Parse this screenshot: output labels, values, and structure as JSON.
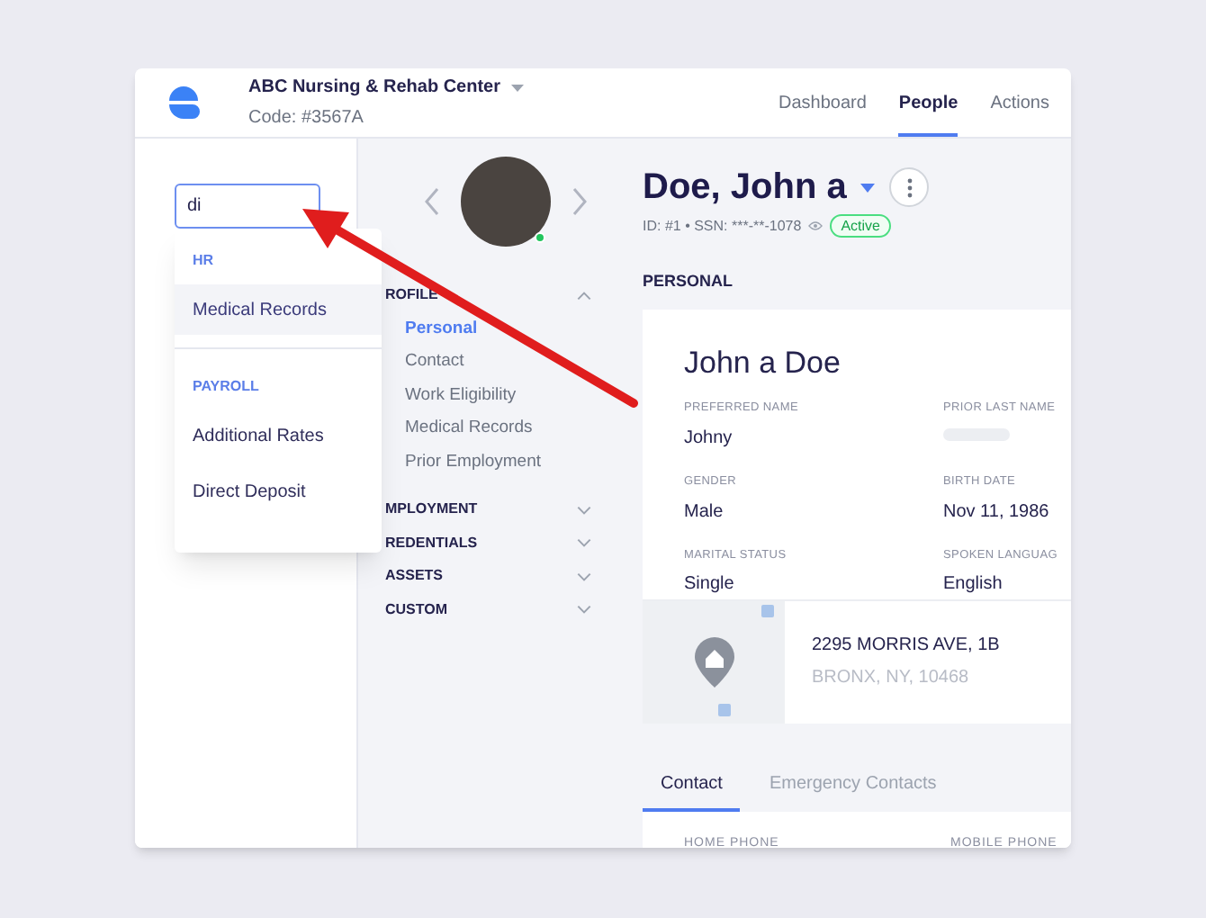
{
  "header": {
    "org_name": "ABC Nursing & Rehab Center",
    "org_code": "Code: #3567A",
    "nav": [
      {
        "label": "Dashboard",
        "selected": false
      },
      {
        "label": "People",
        "selected": true
      },
      {
        "label": "Actions",
        "selected": false
      }
    ]
  },
  "search": {
    "value": "di"
  },
  "search_results": [
    {
      "group": "HR",
      "items": [
        {
          "label": "Medical Records",
          "selected": true
        }
      ]
    },
    {
      "group": "PAYROLL",
      "items": [
        {
          "label": "Additional Rates",
          "selected": false
        },
        {
          "label": "Direct Deposit",
          "selected": false
        }
      ]
    }
  ],
  "person": {
    "name": "Doe, John a",
    "id_line": "ID: #1 • SSN: ***-**-1078",
    "status": "Active",
    "online": true
  },
  "sections": [
    {
      "label": "ROFILE",
      "expanded": true,
      "children": [
        {
          "label": "Personal",
          "selected": true
        },
        {
          "label": "Contact",
          "selected": false
        },
        {
          "label": "Work Eligibility",
          "selected": false
        },
        {
          "label": "Medical Records",
          "selected": false
        },
        {
          "label": "Prior Employment",
          "selected": false
        }
      ]
    },
    {
      "label": "MPLOYMENT",
      "expanded": false
    },
    {
      "label": "REDENTIALS",
      "expanded": false
    },
    {
      "label": "ASSETS",
      "expanded": false
    },
    {
      "label": "CUSTOM",
      "expanded": false
    }
  ],
  "panel": {
    "heading": "PERSONAL",
    "full_name": "John a Doe",
    "fields": [
      {
        "label": "PREFERRED NAME",
        "kind": "text",
        "value": "Johny"
      },
      {
        "label": "PRIOR LAST NAME",
        "kind": "redacted"
      },
      {
        "label": "GENDER",
        "kind": "text",
        "value": "Male"
      },
      {
        "label": "BIRTH DATE",
        "kind": "text",
        "value": "Nov 11, 1986"
      },
      {
        "label": "MARITAL STATUS",
        "kind": "text",
        "value": "Single"
      },
      {
        "label": "SPOKEN LANGUAG",
        "kind": "text",
        "value": "English"
      }
    ],
    "address": {
      "line1": "2295 MORRIS AVE, 1B",
      "line2": "BRONX, NY, 10468"
    }
  },
  "contact_tabs": [
    {
      "label": "Contact",
      "selected": true
    },
    {
      "label": "Emergency Contacts",
      "selected": false
    }
  ],
  "contact_fields": [
    {
      "label": "HOME PHONE"
    },
    {
      "label": "MOBILE PHONE"
    }
  ]
}
